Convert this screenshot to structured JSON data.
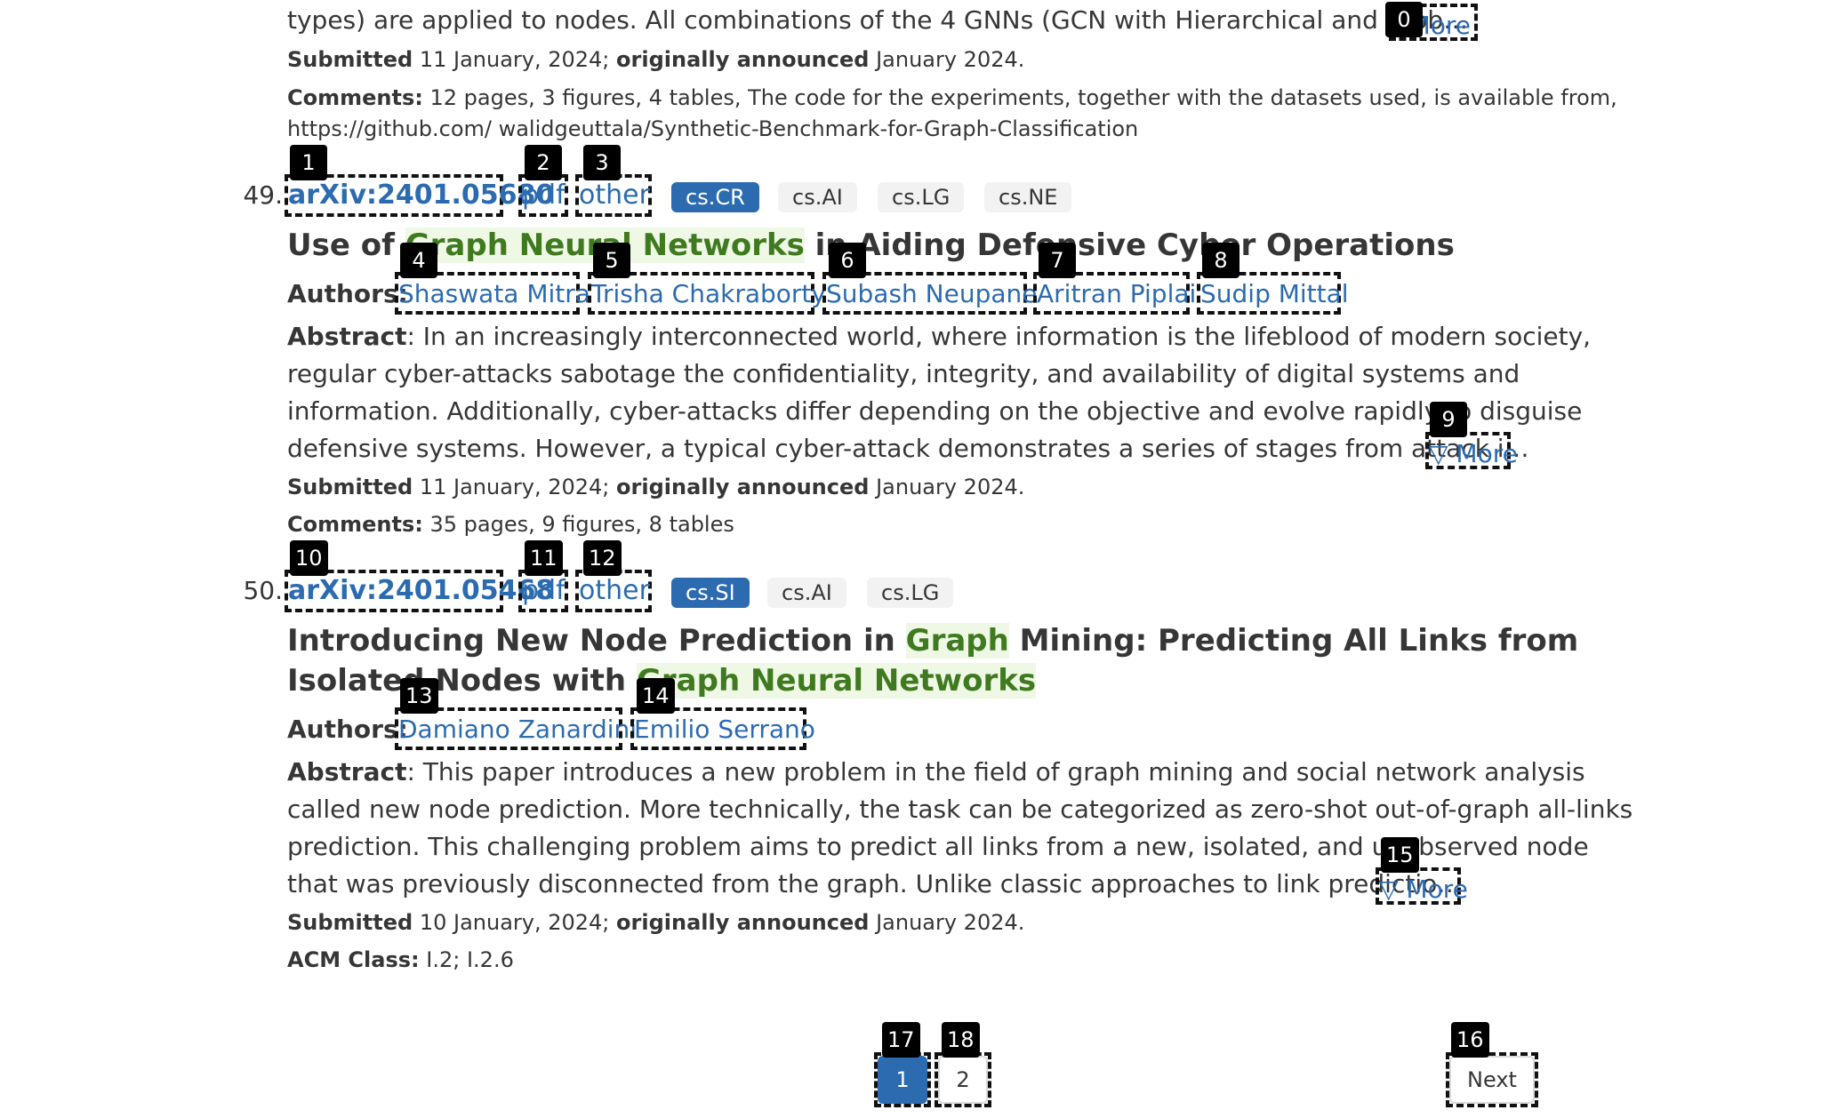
{
  "prev": {
    "abstract_tail": "types) are applied to nodes. All combinations of the 4 GNNs (GCN with Hierarchical and Glob…",
    "more_label": "More",
    "submitted_label": "Submitted",
    "submitted_date": " 11 January, 2024; ",
    "announced_label": "originally announced",
    "announced_date": " January 2024.",
    "comments_label": "Comments:",
    "comments_line1": " 12 pages, 3 figures, 4 tables, The code for the experiments, together with the datasets used, is available from,",
    "comments_line2": "https://github.com/ walidgeuttala/Synthetic-Benchmark-for-Graph-Classification"
  },
  "results": [
    {
      "number": "49.",
      "arxiv_id": "arXiv:2401.05680",
      "pdf_label": "pdf",
      "other_label": "other",
      "tags": [
        "cs.CR",
        "cs.AI",
        "cs.LG",
        "cs.NE"
      ],
      "title_pre": "Use of ",
      "title_hl": "Graph Neural Networks",
      "title_post": " in Aiding Defensive Cyber Operations",
      "authors_label": "Authors:",
      "authors": [
        "Shaswata Mitra",
        "Trisha Chakraborty",
        "Subash Neupane",
        "Aritran Piplai",
        "Sudip Mittal"
      ],
      "abstract_label": "Abstract",
      "abstract_lines": [
        ": In an increasingly interconnected world, where information is the lifeblood of modern society,",
        "regular cyber-attacks sabotage the confidentiality, integrity, and availability of digital systems and",
        "information. Additionally, cyber-attacks differ depending on the objective and evolve rapidly to disguise",
        "defensive systems. However, a typical cyber-attack demonstrates a series of stages from attack i…"
      ],
      "more_label": "▽ More",
      "submitted_label": "Submitted",
      "submitted_date": " 11 January, 2024; ",
      "announced_label": "originally announced",
      "announced_date": " January 2024.",
      "extra_label": "Comments:",
      "extra_value": " 35 pages, 9 figures, 8 tables"
    },
    {
      "number": "50.",
      "arxiv_id": "arXiv:2401.05468",
      "pdf_label": "pdf",
      "other_label": "other",
      "tags": [
        "cs.SI",
        "cs.AI",
        "cs.LG"
      ],
      "title_line1_pre": "Introducing New Node Prediction in ",
      "title_line1_hl": "Graph",
      "title_line1_post": " Mining: Predicting All Links from",
      "title_line2_pre": "Isolated Nodes with ",
      "title_line2_hl": "Graph Neural Networks",
      "authors_label": "Authors:",
      "authors": [
        "Damiano Zanardini",
        "Emilio Serrano"
      ],
      "abstract_label": "Abstract",
      "abstract_lines": [
        ": This paper introduces a new problem in the field of graph mining and social network analysis",
        "called new node prediction. More technically, the task can be categorized as zero-shot out-of-graph all-links",
        "prediction. This challenging problem aims to predict all links from a new, isolated, and unobserved node",
        "that was previously disconnected from the graph. Unlike classic approaches to link predictio…"
      ],
      "more_label": "▽ More",
      "submitted_label": "Submitted",
      "submitted_date": " 10 January, 2024; ",
      "announced_label": "originally announced",
      "announced_date": " January 2024.",
      "extra_label": "ACM Class:",
      "extra_value": " I.2; I.2.6"
    }
  ],
  "pagination": {
    "pages": [
      "1",
      "2"
    ],
    "next_label": "Next"
  },
  "badges": [
    "0",
    "1",
    "2",
    "3",
    "4",
    "5",
    "6",
    "7",
    "8",
    "9",
    "10",
    "11",
    "12",
    "13",
    "14",
    "15",
    "16",
    "17",
    "18"
  ],
  "colors": {
    "link": "#2c6bb0",
    "highlight_text": "#3f7a20",
    "highlight_bg": "#eef8e4",
    "primary_tag": "#2c6bb0"
  }
}
